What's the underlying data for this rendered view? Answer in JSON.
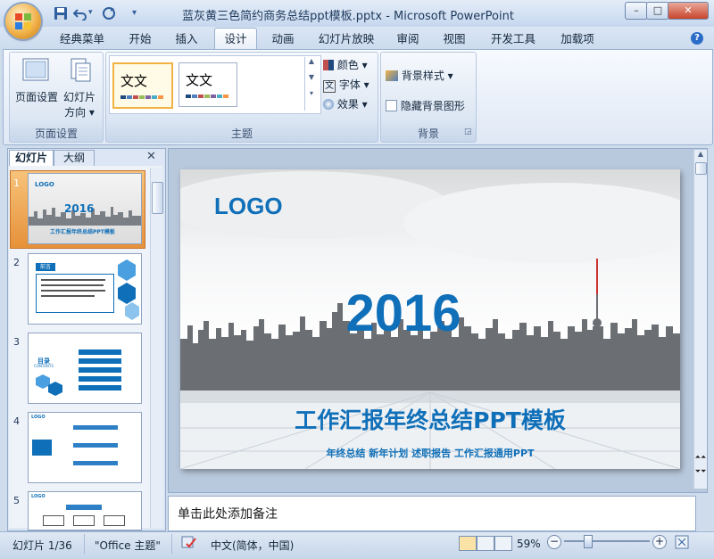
{
  "window": {
    "title": "蓝灰黄三色简约商务总结ppt模板.pptx - Microsoft PowerPoint",
    "minimize": "–",
    "maximize": "□",
    "close": "✕"
  },
  "qat": {
    "save_icon": "save-icon",
    "undo_icon": "undo-icon",
    "redo_icon": "redo-icon",
    "customize": "▾"
  },
  "tabs": [
    "经典菜单",
    "开始",
    "插入",
    "设计",
    "动画",
    "幻灯片放映",
    "审阅",
    "视图",
    "开发工具",
    "加载项"
  ],
  "active_tab": "设计",
  "ribbon": {
    "page_setup": {
      "page_setup_label": "页面设置",
      "orientation_line1": "幻灯片",
      "orientation_line2": "方向 ▾",
      "group_label": "页面设置"
    },
    "themes": {
      "tile1": "文文",
      "tile2": "文文",
      "colors": "颜色 ▾",
      "fonts": "字体 ▾",
      "effects": "效果 ▾",
      "group_label": "主题"
    },
    "background": {
      "styles": "背景样式 ▾",
      "hide_graphics": "隐藏背景图形",
      "group_label": "背景"
    }
  },
  "left_pane": {
    "tab_slides": "幻灯片",
    "tab_outline": "大纲",
    "close": "✕",
    "slide_numbers": [
      "1",
      "2",
      "3",
      "4",
      "5"
    ],
    "thumb1": {
      "logo": "LOGO",
      "year": "2016",
      "title": "工作汇报年终总结PPT模板"
    },
    "thumb2": {
      "label": "前言"
    },
    "thumb3": {
      "label": "目录",
      "sub": "CONTENTS"
    },
    "thumb4": {
      "label": "LOGO"
    },
    "thumb5": {
      "label": "LOGO"
    }
  },
  "slide": {
    "logo": "LOGO",
    "year": "2016",
    "title": "工作汇报年终总结PPT模板",
    "subtitle": "年终总结 新年计划 述职报告 工作汇报通用PPT",
    "accent_color": "#0f6fb8"
  },
  "notes": {
    "placeholder": "单击此处添加备注"
  },
  "status": {
    "slide_info": "幻灯片 1/36",
    "theme": "\"Office 主题\"",
    "language": "中文(简体，中国)",
    "zoom": "59%",
    "zoom_out": "−",
    "zoom_in": "+"
  }
}
